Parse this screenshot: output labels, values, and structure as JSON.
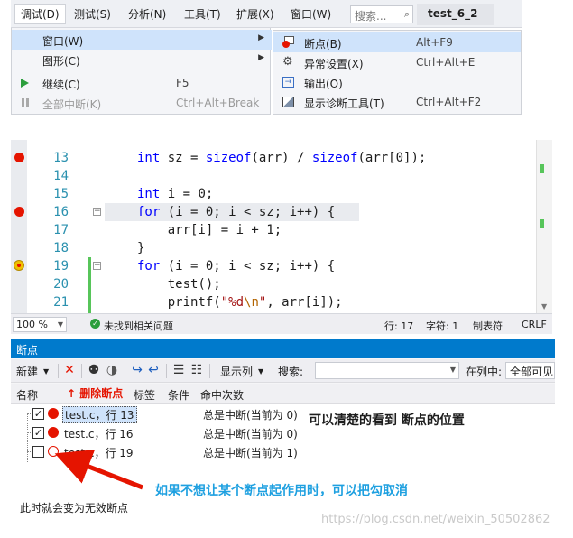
{
  "menubar": {
    "items": [
      "调试(D)",
      "测试(S)",
      "分析(N)",
      "工具(T)",
      "扩展(X)",
      "窗口(W)"
    ],
    "search_placeholder": "搜索...",
    "project_title": "test_6_2"
  },
  "debug_menu": {
    "items": [
      {
        "label": "窗口(W)",
        "shortcut": ""
      },
      {
        "label": "图形(C)",
        "shortcut": ""
      },
      {
        "label": "继续(C)",
        "shortcut": "F5"
      },
      {
        "label": "全部中断(K)",
        "shortcut": "Ctrl+Alt+Break"
      }
    ]
  },
  "windows_submenu": {
    "items": [
      {
        "label": "断点(B)",
        "shortcut": "Alt+F9",
        "icon": "breakpoints-window-icon"
      },
      {
        "label": "异常设置(X)",
        "shortcut": "Ctrl+Alt+E",
        "icon": "exception-settings-icon"
      },
      {
        "label": "输出(O)",
        "shortcut": "",
        "icon": "output-icon"
      },
      {
        "label": "显示诊断工具(T)",
        "shortcut": "Ctrl+Alt+F2",
        "icon": "diagnostic-tools-icon"
      }
    ]
  },
  "editor": {
    "lines": [
      {
        "num": "13",
        "breakpoint": "enabled"
      },
      {
        "num": "14",
        "breakpoint": "none"
      },
      {
        "num": "15",
        "breakpoint": "none"
      },
      {
        "num": "16",
        "breakpoint": "enabled"
      },
      {
        "num": "17",
        "breakpoint": "none"
      },
      {
        "num": "18",
        "breakpoint": "none"
      },
      {
        "num": "19",
        "breakpoint": "disabled"
      },
      {
        "num": "20",
        "breakpoint": "none"
      },
      {
        "num": "21",
        "breakpoint": "none"
      }
    ],
    "code": {
      "l13": {
        "kw1": "int",
        "t1": " sz = ",
        "kw2": "sizeof",
        "t2": "(arr) / ",
        "kw3": "sizeof",
        "t3": "(arr[0]);"
      },
      "l15": {
        "kw1": "int",
        "t1": " i = 0;"
      },
      "l16": {
        "kw1": "for",
        "t1": " (i = 0; i < sz; i++) {"
      },
      "l17": {
        "t1": "    arr[i] = i + 1;"
      },
      "l18": {
        "t1": "}"
      },
      "l19": {
        "kw1": "for",
        "t1": " (i = 0; i < sz; i++) {"
      },
      "l20": {
        "t1": "    test();"
      },
      "l21": {
        "t1": "    printf(",
        "s1": "\"%d",
        "e1": "\\n",
        "s2": "\"",
        "t2": ", arr[i]);"
      }
    },
    "status": {
      "zoom": "100 %",
      "issues": "未找到相关问题",
      "line": "行: 17",
      "char": "字符: 1",
      "tabs": "制表符",
      "eol": "CRLF"
    }
  },
  "breakpoints_window": {
    "title": "断点",
    "toolbar": {
      "new_label": "新建",
      "show_columns_label": "显示列",
      "search_label": "搜索:",
      "search_value": "",
      "in_column_label": "在列中:",
      "in_column_value": "全部可见"
    },
    "columns": [
      "名称",
      "标签",
      "条件",
      "命中次数"
    ],
    "rows": [
      {
        "name": "test.c，行 13",
        "checked": true,
        "hit_count": "总是中断(当前为 0)",
        "selected": true
      },
      {
        "name": "test.c，行 16",
        "checked": true,
        "hit_count": "总是中断(当前为 0)",
        "selected": false
      },
      {
        "name": "test.c，行 19",
        "checked": false,
        "hit_count": "总是中断(当前为 1)",
        "selected": false
      }
    ]
  },
  "annotations": {
    "delete_breakpoint": "↑ 删除断点",
    "clear_view": "可以清楚的看到 断点的位置",
    "hint": "如果不想让某个断点起作用时，可以把勾取消",
    "footnote": "此时就会变为无效断点",
    "arrow_color": "#e51400"
  },
  "watermark": "https://blog.csdn.net/weixin_50502862"
}
